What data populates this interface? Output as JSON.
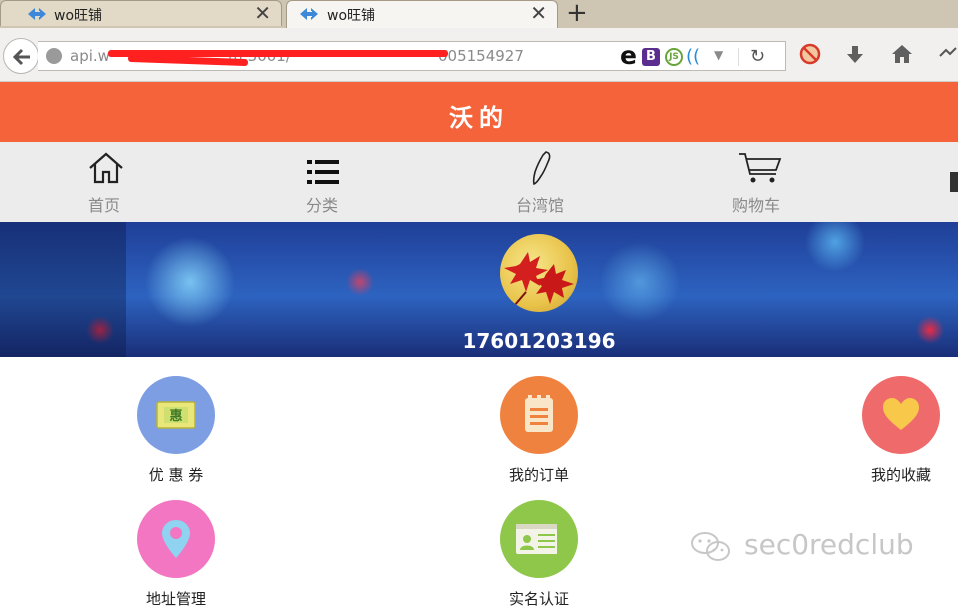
{
  "browser": {
    "tabs": [
      {
        "title": "wo旺铺",
        "active": false
      },
      {
        "title": "wo旺铺",
        "active": true
      }
    ],
    "new_tab": "+",
    "url_visible_left": "api.w",
    "url_visible_mid": "m:3001/",
    "url_visible_right": "005154927",
    "redaction_color": "#ff2020",
    "extensions": {
      "e": "e",
      "b": "B",
      "js": "JS",
      "w": "((",
      "dropdown": "▼"
    },
    "toolbar_icons": [
      "reload-icon",
      "blocked-icon",
      "download-icon",
      "home-icon",
      "extensions-icon"
    ]
  },
  "header": {
    "title": "沃的",
    "color": "#f5633a"
  },
  "nav": {
    "items": [
      {
        "label": "首页",
        "icon": "home-icon"
      },
      {
        "label": "分类",
        "icon": "list-icon"
      },
      {
        "label": "台湾馆",
        "icon": "taiwan-map-icon"
      },
      {
        "label": "购物车",
        "icon": "cart-icon"
      }
    ]
  },
  "profile": {
    "phone": "17601203196"
  },
  "menu": {
    "items": [
      {
        "label": "优 惠 券",
        "icon": "coupon-icon",
        "color": "#7d9ee3"
      },
      {
        "label": "我的订单",
        "icon": "order-icon",
        "color": "#f0823f"
      },
      {
        "label": "我的收藏",
        "icon": "heart-icon",
        "color": "#ef6b6b"
      },
      {
        "label": "地址管理",
        "icon": "location-icon",
        "color": "#f276c1"
      },
      {
        "label": "实名认证",
        "icon": "id-card-icon",
        "color": "#8fc74b"
      }
    ]
  },
  "watermark": {
    "text": "sec0redclub"
  }
}
